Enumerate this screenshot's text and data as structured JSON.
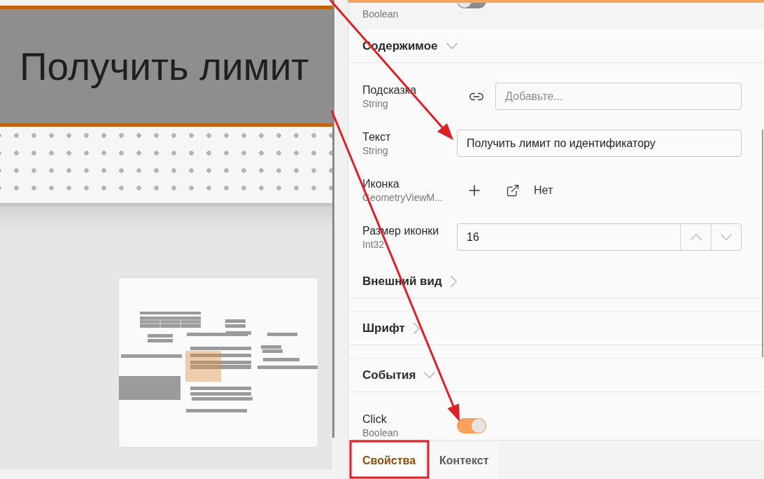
{
  "canvas": {
    "node_title": "Получить лимит"
  },
  "properties_panel": {
    "cut_row": {
      "kind": "toggle",
      "type": "Boolean",
      "on": false
    },
    "sections": [
      {
        "title": "Содержимое",
        "expanded": true,
        "properties": [
          {
            "kind": "link",
            "name": "Подсказка",
            "type": "String",
            "placeholder": "Добавьте..."
          },
          {
            "kind": "text",
            "name": "Текст",
            "type": "String",
            "value": "Получить лимит по идентификатору"
          },
          {
            "kind": "icon",
            "name": "Иконка",
            "type": "GeometryViewM...",
            "value": "Нет"
          },
          {
            "kind": "number",
            "name": "Размер иконки",
            "type": "Int32",
            "value": "16"
          }
        ]
      },
      {
        "title": "Внешний вид",
        "expanded": false
      },
      {
        "title": "Шрифт",
        "expanded": false
      },
      {
        "title": "События",
        "expanded": true,
        "properties": [
          {
            "kind": "toggle",
            "name": "Click",
            "type": "Boolean",
            "on": true
          }
        ]
      }
    ]
  },
  "tabs": [
    {
      "label": "Свойства",
      "selected": true
    },
    {
      "label": "Контекст",
      "selected": false
    }
  ]
}
